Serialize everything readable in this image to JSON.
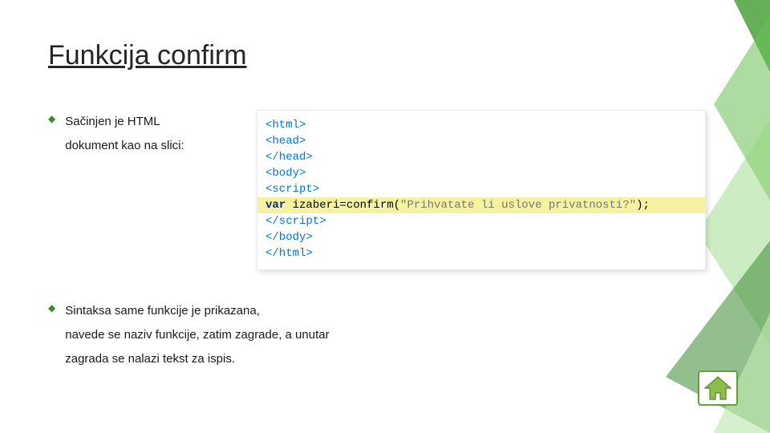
{
  "title": "Funkcija confirm",
  "bullets": {
    "b1_line1": "Sačinjen je HTML",
    "b1_line2": "dokument kao na slici:",
    "b2_line1": "Sintaksa same funkcije je prikazana,",
    "b2_line2": "navede se naziv funkcije, zatim zagrade, a unutar",
    "b2_line3": "zagrada se nalazi tekst za ispis."
  },
  "code": {
    "l1": "<html>",
    "l2": "<head>",
    "l3": "</head>",
    "l4": "<body>",
    "l5": "<script>",
    "hl_kw": "var",
    "hl_rest": " izaberi=confirm",
    "hl_paren_open": "(",
    "hl_string": "\"Prihvatate li uslove privatnosti?\"",
    "hl_paren_close": ");",
    "l7": "</script>",
    "l8": "</body>",
    "l9": "</html>"
  },
  "icons": {
    "home": "home-icon"
  },
  "colors": {
    "accent": "#3a8a32",
    "highlight": "#f6f2a0",
    "tag": "#0077d6",
    "keyword": "#0b2a7a"
  }
}
